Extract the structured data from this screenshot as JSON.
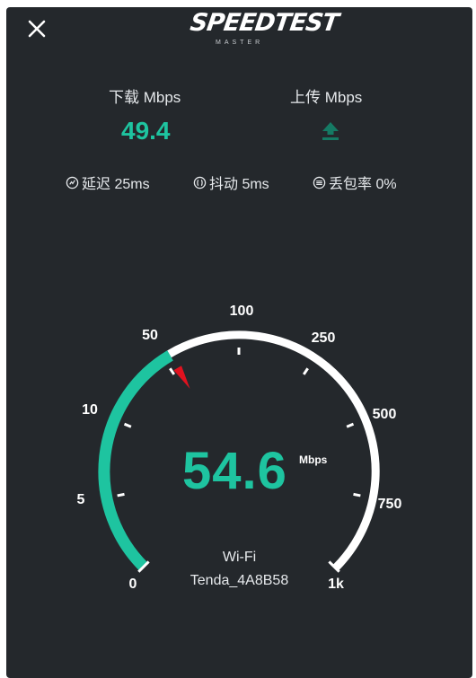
{
  "header": {
    "close_icon": "close-icon",
    "logo_text": "SPEEDTEST",
    "logo_subtext": "MASTER"
  },
  "metrics": {
    "download_label": "下载 Mbps",
    "download_value": "49.4",
    "upload_label": "上传 Mbps",
    "upload_icon": "upload-arrow-icon"
  },
  "stats": {
    "latency": "延迟 25ms",
    "jitter": "抖动 5ms",
    "packet_loss": "丢包率 0%"
  },
  "gauge": {
    "current_speed": "54.6",
    "unit": "Mbps",
    "tick_labels": [
      "0",
      "5",
      "10",
      "50",
      "100",
      "250",
      "500",
      "750",
      "1k"
    ],
    "fill_value": 54.6
  },
  "network": {
    "type": "Wi-Fi",
    "name": "Tenda_4A8B58"
  },
  "colors": {
    "background": "#24282c",
    "accent": "#1ec4a0",
    "needle": "#e0121f",
    "track": "#ffffff"
  }
}
